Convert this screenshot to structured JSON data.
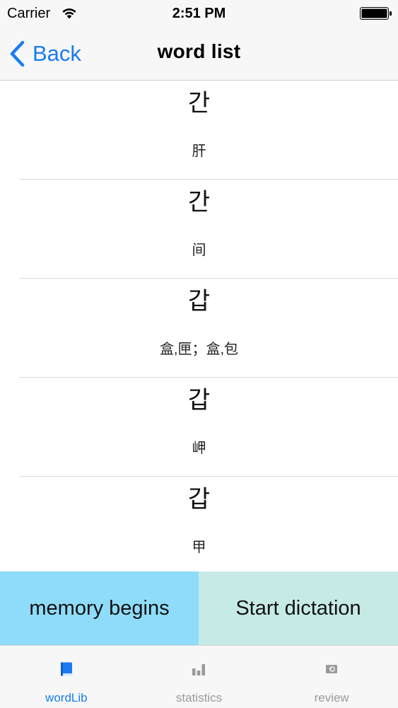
{
  "status_bar": {
    "carrier": "Carrier",
    "time": "2:51 PM",
    "wifi_icon": "wifi-icon",
    "battery_icon": "battery-icon"
  },
  "nav": {
    "back_label": "Back",
    "title": "word list",
    "accent_color": "#1a7cf0"
  },
  "words": [
    {
      "korean": "간",
      "meaning": "肝"
    },
    {
      "korean": "간",
      "meaning": "间"
    },
    {
      "korean": "갑",
      "meaning": "盒,匣；盒,包"
    },
    {
      "korean": "갑",
      "meaning": "岬"
    },
    {
      "korean": "갑",
      "meaning": "甲"
    }
  ],
  "actions": {
    "memory_label": "memory begins",
    "memory_color": "#8edcfa",
    "dictation_label": "Start dictation",
    "dictation_color": "#c6ebe6"
  },
  "tabs": [
    {
      "label": "wordLib",
      "icon": "book-icon",
      "active": true
    },
    {
      "label": "statistics",
      "icon": "bar-chart-icon",
      "active": false
    },
    {
      "label": "review",
      "icon": "review-icon",
      "active": false
    }
  ]
}
